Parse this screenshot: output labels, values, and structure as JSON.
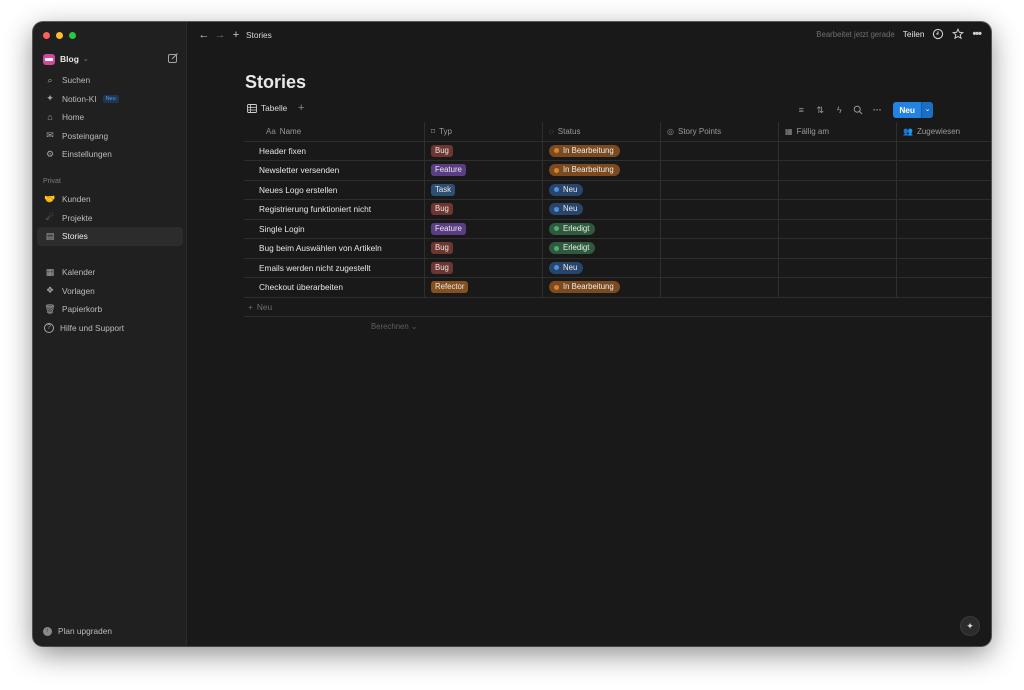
{
  "window": {
    "traffic_colors": [
      "#ff5f57",
      "#febc2e",
      "#28c840"
    ]
  },
  "sidebar": {
    "workspace": "Blog",
    "top_items": [
      {
        "label": "Suchen",
        "icon": "search-icon"
      },
      {
        "label": "Notion-KI",
        "icon": "sparkle-icon",
        "badge": "Neu"
      },
      {
        "label": "Home",
        "icon": "home-icon"
      },
      {
        "label": "Posteingang",
        "icon": "inbox-icon"
      },
      {
        "label": "Einstellungen",
        "icon": "gear-icon"
      }
    ],
    "section_label": "Privat",
    "private_items": [
      {
        "label": "Kunden",
        "icon": "handshake-icon"
      },
      {
        "label": "Projekte",
        "icon": "comet-icon"
      },
      {
        "label": "Stories",
        "icon": "document-icon",
        "active": true
      }
    ],
    "bottom_items": [
      {
        "label": "Kalender",
        "icon": "calendar-icon"
      },
      {
        "label": "Vorlagen",
        "icon": "templates-icon"
      },
      {
        "label": "Papierkorb",
        "icon": "trash-icon"
      },
      {
        "label": "Hilfe und Support",
        "icon": "help-icon"
      }
    ],
    "upgrade": "Plan upgraden"
  },
  "topbar": {
    "breadcrumb": "Stories",
    "edited": "Bearbeitet jetzt gerade",
    "share": "Teilen"
  },
  "page": {
    "title": "Stories",
    "view_tab": "Tabelle",
    "new_button": "Neu"
  },
  "table": {
    "headers": [
      {
        "label": "Name",
        "prefix": "Aa"
      },
      {
        "label": "Typ",
        "icon": "bookmark-icon"
      },
      {
        "label": "Status",
        "icon": "status-icon"
      },
      {
        "label": "Story Points",
        "icon": "number-icon"
      },
      {
        "label": "Fällig am",
        "icon": "calendar-icon"
      },
      {
        "label": "Zugewiesen",
        "icon": "people-icon"
      }
    ],
    "rows": [
      {
        "name": "Header fixen",
        "typ": "Bug",
        "status": "In Bearbeitung"
      },
      {
        "name": "Newsletter versenden",
        "typ": "Feature",
        "status": "In Bearbeitung"
      },
      {
        "name": "Neues Logo erstellen",
        "typ": "Task",
        "status": "Neu"
      },
      {
        "name": "Registrierung funktioniert nicht",
        "typ": "Bug",
        "status": "Neu"
      },
      {
        "name": "Single Login",
        "typ": "Feature",
        "status": "Erledigt"
      },
      {
        "name": "Bug beim Auswählen von Artikeln",
        "typ": "Bug",
        "status": "Erledigt"
      },
      {
        "name": "Emails werden nicht zugestellt",
        "typ": "Bug",
        "status": "Neu"
      },
      {
        "name": "Checkout überarbeiten",
        "typ": "Refector",
        "status": "In Bearbeitung"
      }
    ],
    "new_row": "Neu",
    "calculate": "Berechnen"
  },
  "colors": {
    "type_bg": {
      "Bug": "#6e3630",
      "Feature": "#5a3d82",
      "Task": "#2c4f74",
      "Refector": "#84501f"
    },
    "status_bg": {
      "In Bearbeitung": "#7b4a1f",
      "Neu": "#28456b",
      "Erledigt": "#2f5a3d"
    },
    "status_dot": {
      "In Bearbeitung": "#d9822b",
      "Neu": "#4d8fe0",
      "Erledigt": "#4caf6f"
    },
    "accent": "#2383e2"
  }
}
